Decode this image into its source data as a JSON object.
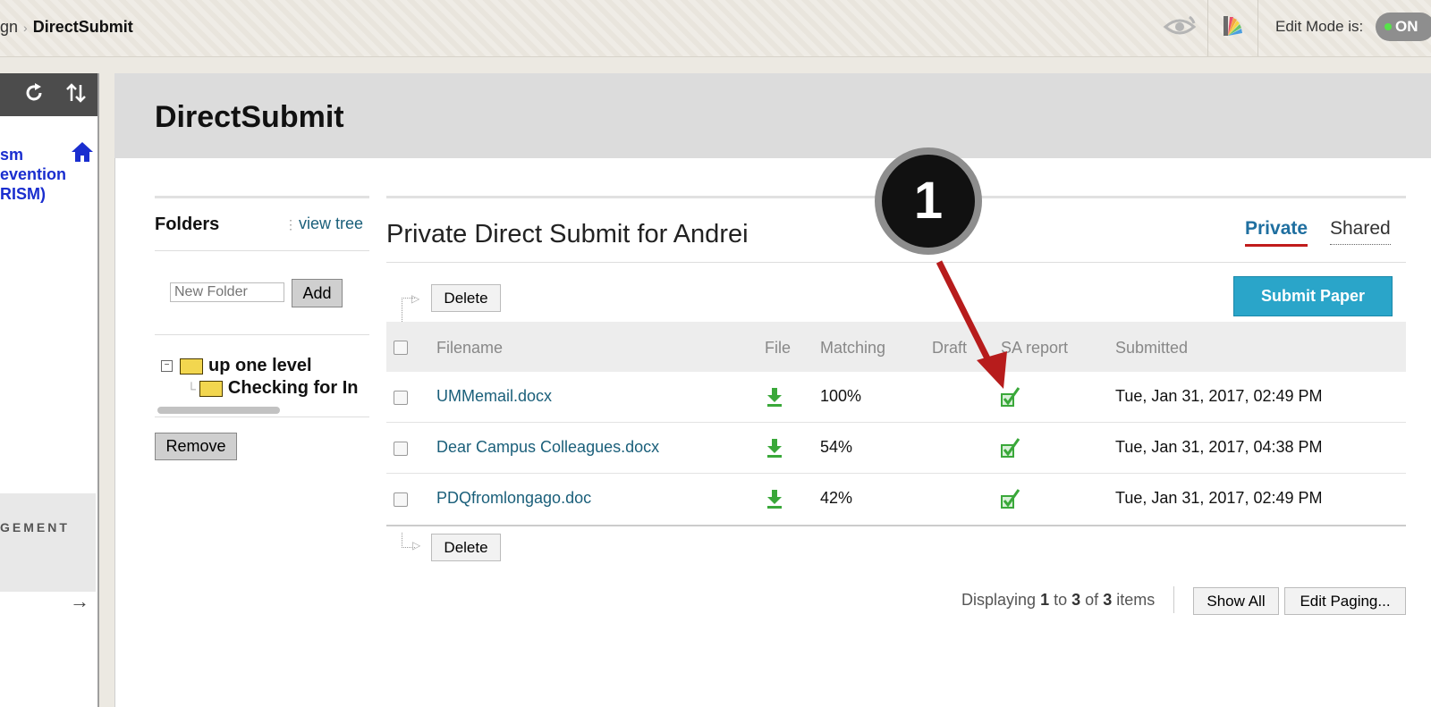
{
  "topbar": {
    "breadcrumb": [
      {
        "label": "gn"
      },
      {
        "label": "DirectSubmit"
      }
    ],
    "breadcrumb_sep": "›",
    "edit_mode_label": "Edit Mode is:",
    "edit_mode_value": "ON",
    "icons": [
      "student-preview-eye-icon",
      "color-palette-icon"
    ]
  },
  "course_menu": {
    "tool_icons": [
      "collapse-icon",
      "refresh-icon",
      "sort-icon"
    ],
    "course_link_lines": [
      "sm",
      "evention",
      "RISM)"
    ],
    "management_label": "GEMENT",
    "arrow": "→",
    "colors": {
      "link": "#1a2ecf"
    }
  },
  "page": {
    "title": "DirectSubmit"
  },
  "folders": {
    "heading": "Folders",
    "view_tree_label": "view tree",
    "new_folder_placeholder": "New Folder",
    "add_label": "Add",
    "tree": [
      {
        "label": "up one level"
      },
      {
        "label": "Checking for In"
      }
    ],
    "remove_label": "Remove"
  },
  "submit_panel": {
    "title": "Private Direct Submit for Andrei",
    "tabs": [
      {
        "label": "Private",
        "active": true
      },
      {
        "label": "Shared",
        "active": false
      }
    ],
    "delete_label": "Delete",
    "submit_label": "Submit Paper",
    "columns": [
      "Filename",
      "File",
      "Matching",
      "Draft",
      "SA report",
      "Submitted"
    ],
    "rows": [
      {
        "filename": "UMMemail.docx",
        "matching": "100%",
        "submitted": "Tue, Jan 31, 2017, 02:49 PM"
      },
      {
        "filename": "Dear Campus Colleagues.docx",
        "matching": "54%",
        "submitted": "Tue, Jan 31, 2017, 04:38 PM"
      },
      {
        "filename": "PDQfromlongago.doc",
        "matching": "42%",
        "submitted": "Tue, Jan 31, 2017, 02:49 PM"
      }
    ],
    "paging": {
      "prefix": "Displaying",
      "from": "1",
      "to_word": "to",
      "to": "3",
      "of_word": "of",
      "total": "3",
      "items_word": "items"
    },
    "show_all_label": "Show All",
    "edit_paging_label": "Edit Paging...",
    "colors": {
      "accent": "#2aa5c9",
      "link": "#1a5f7a",
      "tab_underline": "#c01c1c"
    }
  },
  "annotation": {
    "callout_number": "1",
    "arrow_color": "#b71c1c"
  }
}
